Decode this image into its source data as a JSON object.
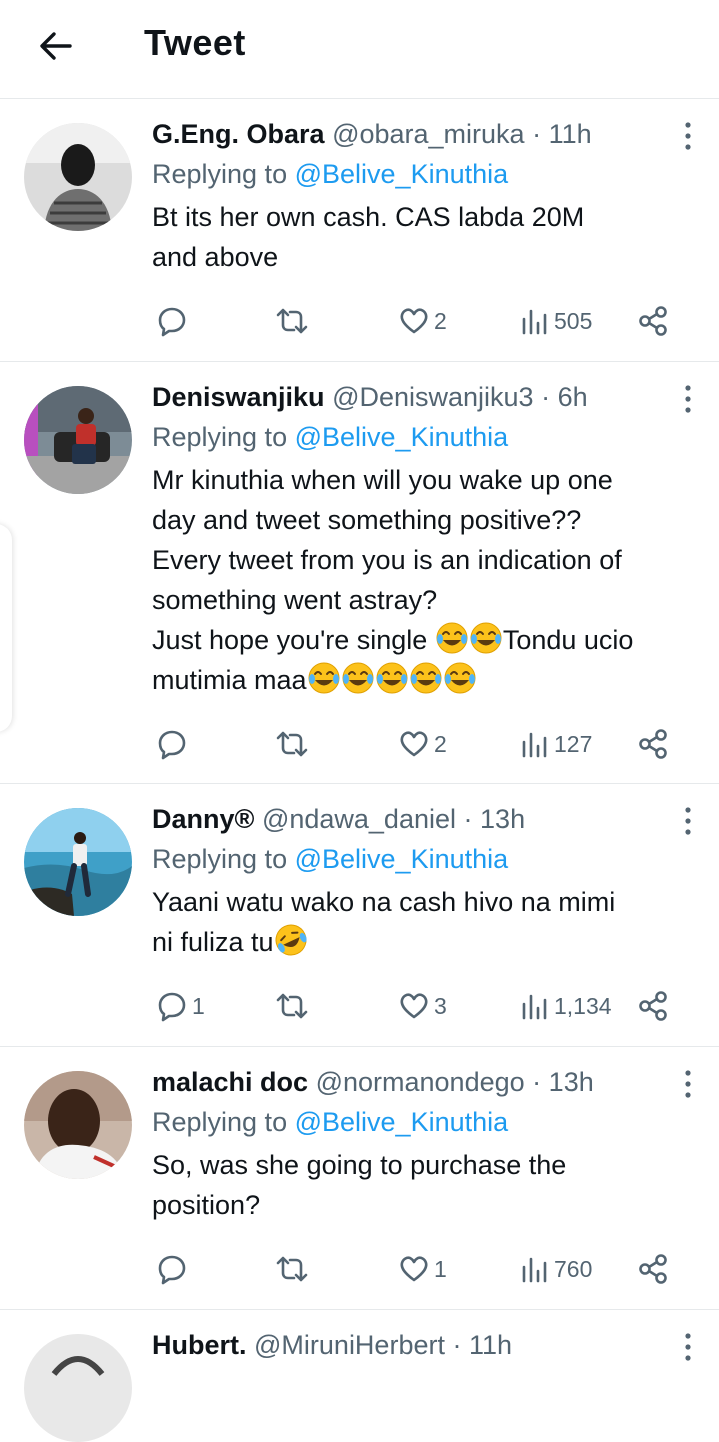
{
  "header": {
    "title": "Tweet"
  },
  "replying_label": "Replying to",
  "replies": [
    {
      "name": "G.Eng. Obara",
      "handle": "@obara_miruka",
      "time": "11h",
      "reply_to": "@Belive_Kinuthia",
      "lines": [
        "Bt its her own cash. CAS labda 20M",
        "and above"
      ],
      "comments": "",
      "likes": "2",
      "views": "505"
    },
    {
      "name": "Deniswanjiku",
      "handle": "@Deniswanjiku3",
      "time": "6h",
      "reply_to": "@Belive_Kinuthia",
      "lines": [
        "Mr kinuthia when will you wake up one",
        "day and tweet something positive??",
        "Every tweet from you  is an indication of",
        "something went astray?",
        "Just hope you're single ",
        "Tondu ucio",
        "mutimia maa"
      ],
      "comments": "",
      "likes": "2",
      "views": "127"
    },
    {
      "name": "Danny®",
      "handle": "@ndawa_daniel",
      "time": "13h",
      "reply_to": "@Belive_Kinuthia",
      "lines": [
        "Yaani watu wako na cash hivo na mimi",
        "ni fuliza tu"
      ],
      "comments": "1",
      "likes": "3",
      "views": "1,134"
    },
    {
      "name": "malachi doc",
      "handle": "@normanondego",
      "time": "13h",
      "reply_to": "@Belive_Kinuthia",
      "lines": [
        "So, was she going to purchase the",
        "position?"
      ],
      "comments": "",
      "likes": "1",
      "views": "760"
    },
    {
      "name": "Hubert.",
      "handle": "@MiruniHerbert",
      "time": "11h"
    }
  ],
  "icons": {
    "back": "arrow-left-icon",
    "more": "more-vertical-icon",
    "reply": "comment-icon",
    "retweet": "retweet-icon",
    "like": "heart-icon",
    "views": "analytics-icon",
    "share": "share-icon",
    "emoji_laugh": "tears-of-joy-emoji",
    "emoji_rofl": "rolling-laughing-emoji"
  },
  "colors": {
    "link": "#1d9bf0",
    "secondary": "#536471",
    "text": "#0f1419",
    "divider": "#e6e9eb"
  }
}
